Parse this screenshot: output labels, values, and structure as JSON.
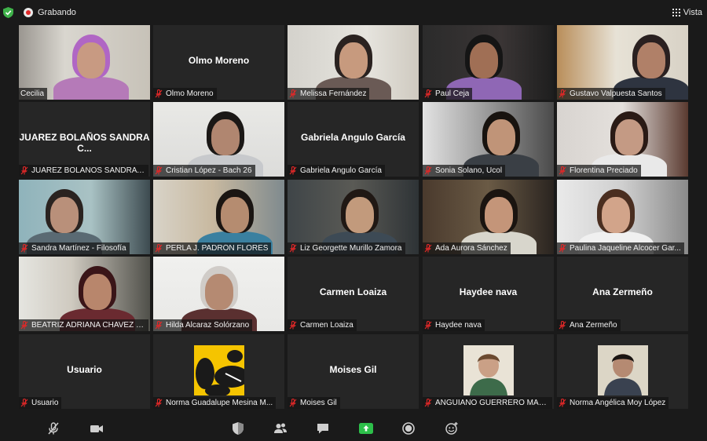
{
  "topbar": {
    "recording_label": "Grabando",
    "view_label": "Vista",
    "icons": [
      "shield-check-icon",
      "record-icon",
      "grid-view-icon"
    ],
    "colors": {
      "shield": "#3fb24a",
      "record": "#e02828"
    }
  },
  "participants": [
    {
      "name": "Cecilia",
      "video": true,
      "active": true,
      "muted": false
    },
    {
      "name": "Olmo Moreno",
      "video": false,
      "muted": true
    },
    {
      "name": "Melissa Fernández",
      "video": true,
      "muted": true
    },
    {
      "name": "Paul Ceja",
      "video": true,
      "muted": true
    },
    {
      "name": "Gustavo Valpuesta Santos",
      "video": true,
      "muted": true
    },
    {
      "name": "JUAREZ BOLAÑOS SANDRA C...",
      "video": false,
      "muted": true
    },
    {
      "name": "Cristian López - Bach 26",
      "video": true,
      "muted": true
    },
    {
      "name": "Gabriela Angulo García",
      "video": false,
      "muted": true
    },
    {
      "name": "Sonia Solano, Ucol",
      "video": true,
      "muted": true
    },
    {
      "name": "Florentina Preciado",
      "video": true,
      "muted": true
    },
    {
      "name": "Sandra Martínez - Filosofía",
      "video": true,
      "muted": true
    },
    {
      "name": "PERLA J. PADRÓN FLORES",
      "video": true,
      "muted": true
    },
    {
      "name": "Liz Georgette Murillo Zamora",
      "video": true,
      "muted": true
    },
    {
      "name": "Ada Aurora Sánchez",
      "video": true,
      "muted": true
    },
    {
      "name": "Paulina Jaqueline Alcocer Gar...",
      "video": true,
      "muted": true
    },
    {
      "name": "BEATRIZ ADRIANA CHAVEZ SU...",
      "video": true,
      "muted": true
    },
    {
      "name": "Hilda Alcaraz Solórzano",
      "video": true,
      "muted": true
    },
    {
      "name": "Carmen Loaiza",
      "video": false,
      "muted": true
    },
    {
      "name": "Haydee nava",
      "video": false,
      "muted": true
    },
    {
      "name": "Ana Zermeño",
      "video": false,
      "muted": true
    },
    {
      "name": "Usuario",
      "video": false,
      "muted": true
    },
    {
      "name": "Norma Guadalupe Mesina M...",
      "video": false,
      "avatar": true,
      "muted": true
    },
    {
      "name": "Moises Gil",
      "video": false,
      "muted": true
    },
    {
      "name": "ANGUIANO GUERRERO MARI...",
      "video": false,
      "avatar": true,
      "muted": true
    },
    {
      "name": "Norma Angélica Moy López",
      "video": false,
      "avatar": true,
      "muted": true
    }
  ],
  "toolbar": {
    "buttons": [
      "mic-muted-icon",
      "video-camera-icon",
      "security-shield-icon",
      "participants-icon",
      "chat-icon",
      "share-screen-icon",
      "record-button-icon",
      "reactions-icon"
    ],
    "colors": {
      "share": "#2dbf4a",
      "muted_red": "#e02828",
      "active_border": "#d6e34a"
    }
  }
}
